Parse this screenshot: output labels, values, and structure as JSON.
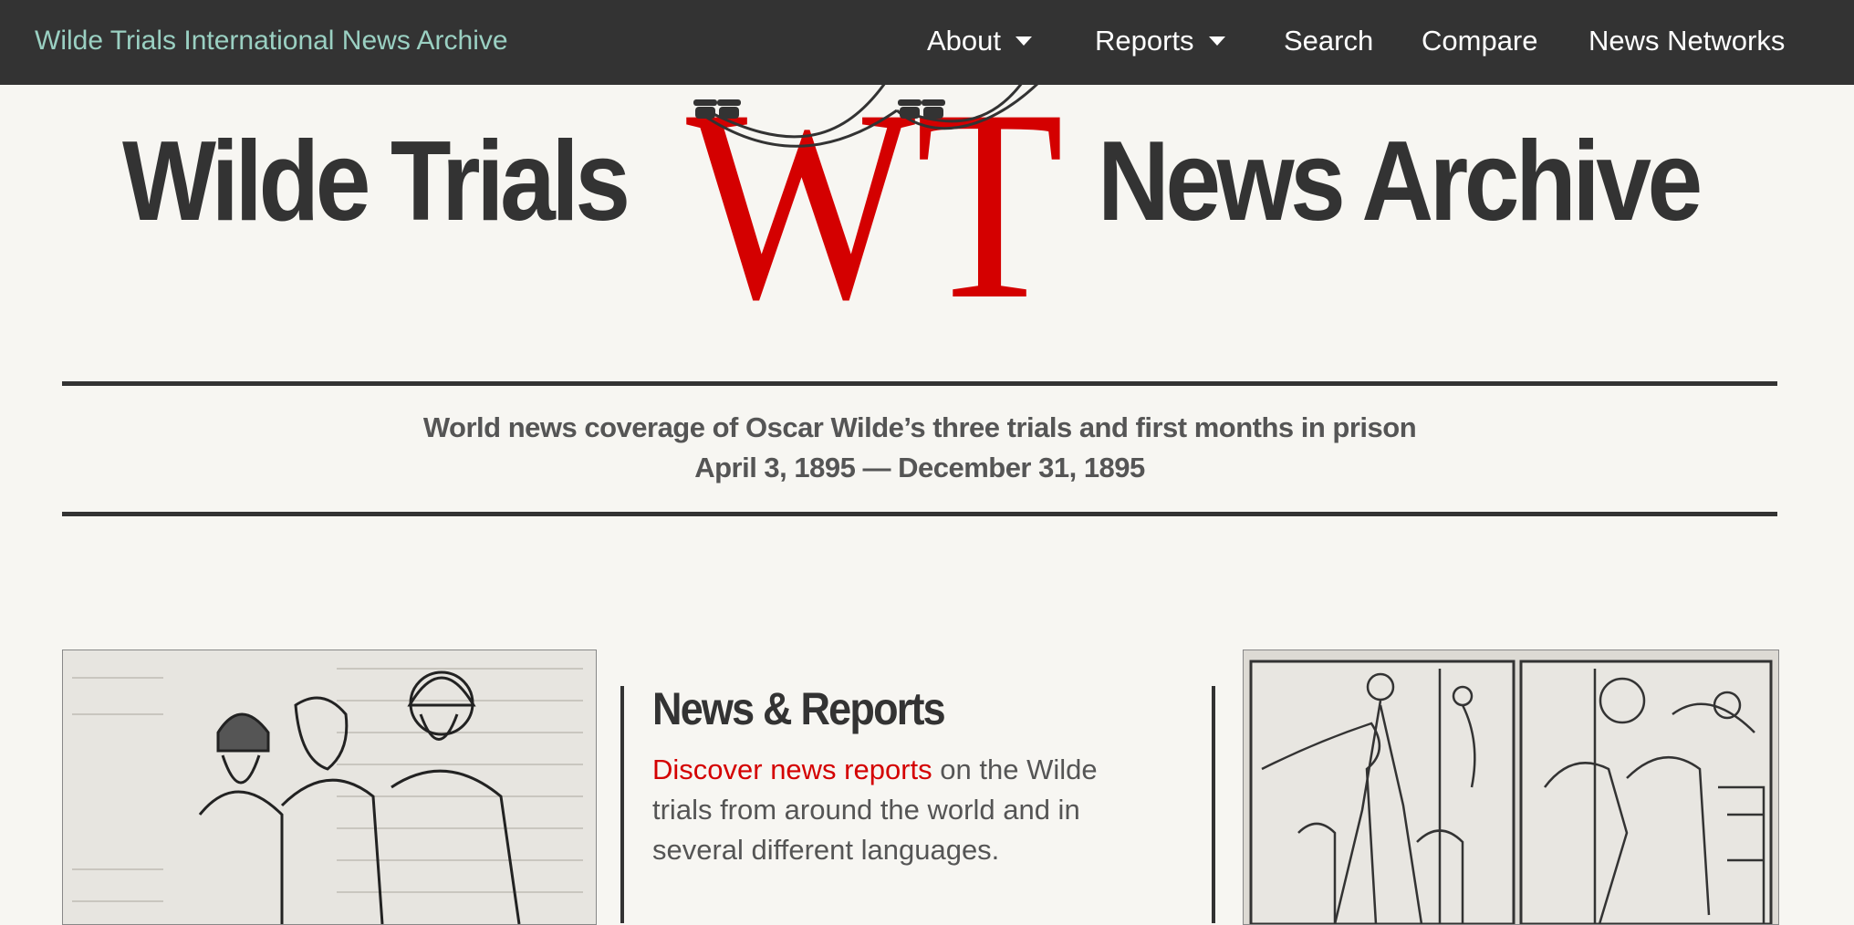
{
  "nav": {
    "brand": "Wilde Trials International News Archive",
    "items": [
      {
        "label": "About",
        "dropdown": true
      },
      {
        "label": "Reports",
        "dropdown": true
      },
      {
        "label": "Search",
        "dropdown": false
      },
      {
        "label": "Compare",
        "dropdown": false
      },
      {
        "label": "News Networks",
        "dropdown": false
      }
    ]
  },
  "masthead": {
    "left": "Wilde Trials",
    "logo_letters": "WT",
    "right": "News Archive"
  },
  "tagline": {
    "line1": "World news coverage of Oscar Wilde’s three trials and first months in prison",
    "line2": "April 3, 1895 — December 31, 1895"
  },
  "feature": {
    "title": "News & Reports",
    "link_text": "Discover news reports",
    "body_text": " on the Wilde trials from around the world and in several different languages."
  },
  "colors": {
    "navbar": "#333333",
    "brand": "#9ad0c2",
    "accent_red": "#d40000",
    "background": "#f7f6f2",
    "text": "#333333"
  },
  "icons": [
    "chevron-down-icon",
    "telegraph-wire-logo-icon"
  ]
}
